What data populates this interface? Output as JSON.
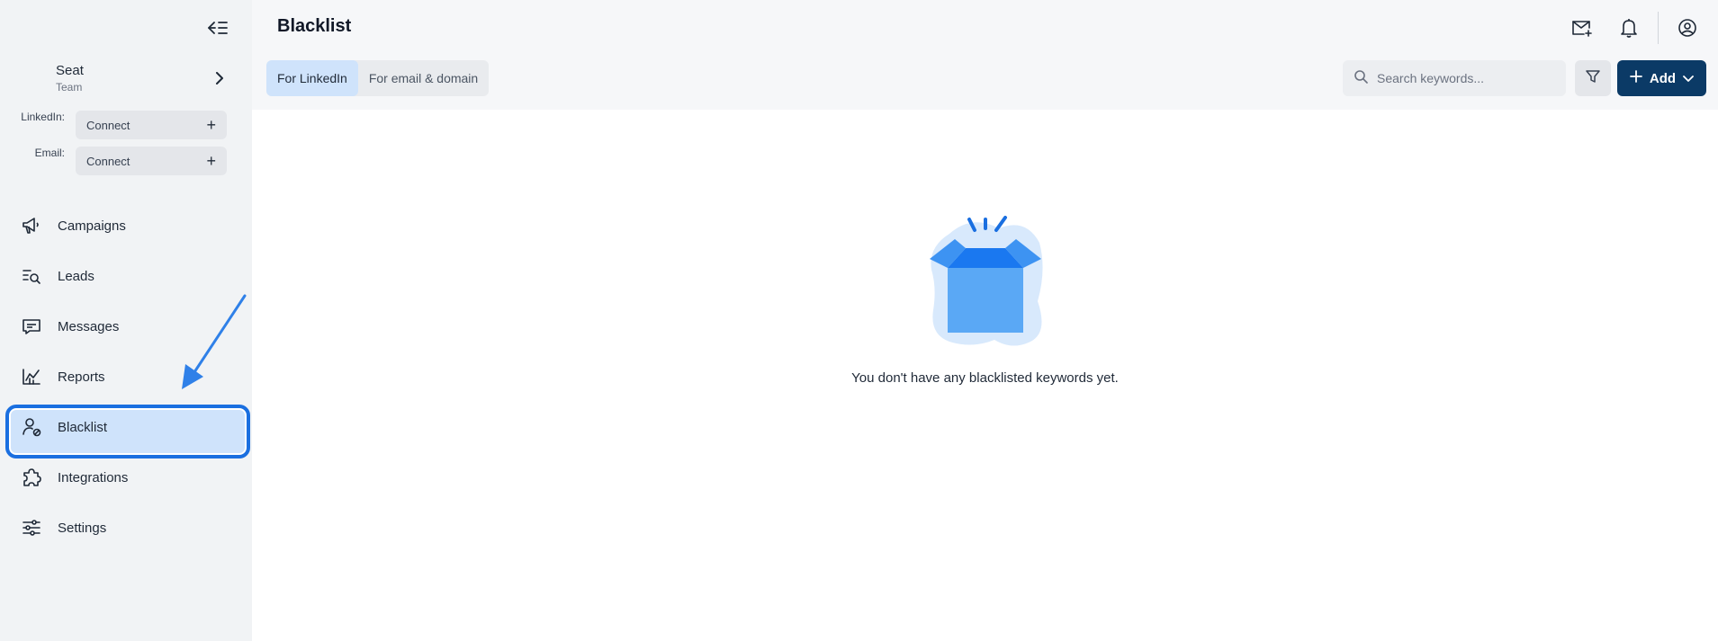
{
  "sidebar": {
    "seat": {
      "name": "Seat",
      "team": "Team"
    },
    "connections": [
      {
        "label": "LinkedIn:",
        "button": "Connect"
      },
      {
        "label": "Email:",
        "button": "Connect"
      }
    ],
    "items": [
      {
        "label": "Campaigns",
        "icon": "megaphone-icon"
      },
      {
        "label": "Leads",
        "icon": "leads-search-icon"
      },
      {
        "label": "Messages",
        "icon": "message-icon"
      },
      {
        "label": "Reports",
        "icon": "chart-icon"
      },
      {
        "label": "Blacklist",
        "icon": "user-block-icon",
        "active": true
      },
      {
        "label": "Integrations",
        "icon": "puzzle-icon"
      },
      {
        "label": "Settings",
        "icon": "sliders-icon"
      }
    ]
  },
  "header": {
    "title": "Blacklist"
  },
  "tabs": [
    {
      "label": "For LinkedIn",
      "active": true
    },
    {
      "label": "For email & domain",
      "active": false
    }
  ],
  "search": {
    "placeholder": "Search keywords..."
  },
  "toolbar": {
    "add_label": "Add"
  },
  "empty_state": {
    "message": "You don't have any blacklisted keywords yet."
  },
  "colors": {
    "accent": "#1a6fe0",
    "primary_button": "#0b3a66",
    "active_bg": "#cfe3fb",
    "sidebar_bg": "#f1f3f5"
  }
}
